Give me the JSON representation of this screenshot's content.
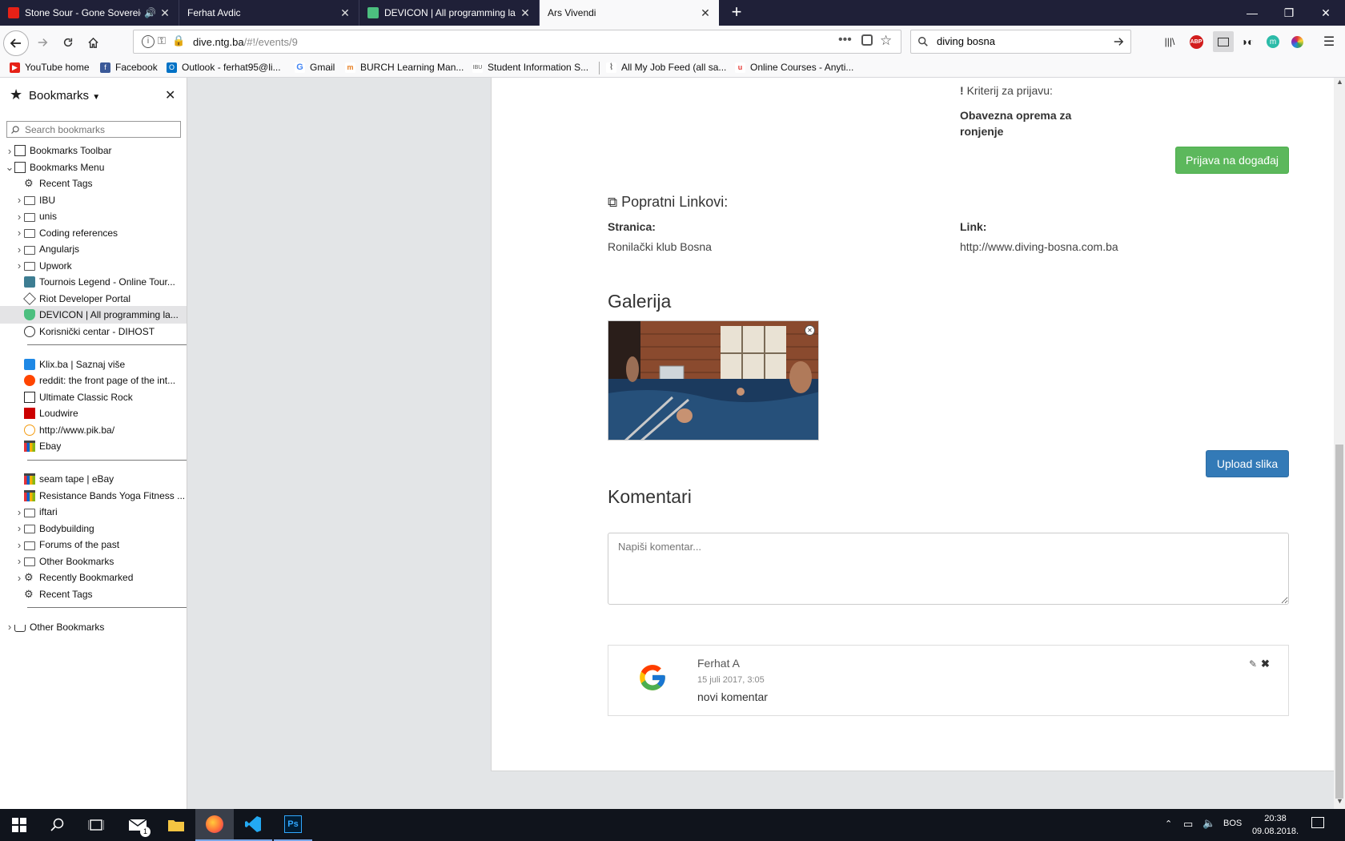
{
  "tabs": [
    {
      "title": "Stone Sour - Gone Sovereign",
      "favicon": "youtube-icon",
      "muted_icon": "speaker-icon"
    },
    {
      "title": "Ferhat Avdic",
      "favicon": "none"
    },
    {
      "title": "DEVICON | All programming la",
      "favicon": "shield-icon"
    },
    {
      "title": "Ars Vivendi",
      "favicon": "none",
      "active": true
    }
  ],
  "new_tab_label": "+",
  "nav": {
    "url_host": "dive.ntg.ba",
    "url_path": "/#!/events/9",
    "search_value": "diving bosna"
  },
  "bookmarks_toolbar": [
    "YouTube home",
    "Facebook",
    "Outlook - ferhat95@li...",
    "Gmail",
    "BURCH Learning Man...",
    "Student Information S...",
    "All My Job Feed (all sa...",
    "Online Courses - Anyti..."
  ],
  "sidebar": {
    "title": "Bookmarks",
    "search_placeholder": "Search bookmarks",
    "items": [
      {
        "label": "Bookmarks Toolbar",
        "level": 0,
        "twisty": "▶",
        "icon": "star-folder"
      },
      {
        "label": "Bookmarks Menu",
        "level": 0,
        "twisty": "▼",
        "icon": "menu-folder"
      },
      {
        "label": "Recent Tags",
        "level": 1,
        "twisty": "",
        "icon": "gear"
      },
      {
        "label": "IBU",
        "level": 1,
        "twisty": "▶",
        "icon": "folder"
      },
      {
        "label": "unis",
        "level": 1,
        "twisty": "▶",
        "icon": "folder"
      },
      {
        "label": "Coding references",
        "level": 1,
        "twisty": "▶",
        "icon": "folder"
      },
      {
        "label": "Angularjs",
        "level": 1,
        "twisty": "▶",
        "icon": "folder"
      },
      {
        "label": "Upwork",
        "level": 1,
        "twisty": "▶",
        "icon": "folder"
      },
      {
        "label": "Tournois Legend - Online Tour...",
        "level": 1,
        "twisty": "",
        "icon": "site-teal"
      },
      {
        "label": "Riot Developer Portal",
        "level": 1,
        "twisty": "",
        "icon": "site-riot"
      },
      {
        "label": "DEVICON | All programming la...",
        "level": 1,
        "twisty": "",
        "icon": "site-green",
        "selected": true
      },
      {
        "label": "Korisnički centar - DIHOST",
        "level": 1,
        "twisty": "",
        "icon": "site-dihost"
      },
      {
        "separator": true
      },
      {
        "label": "Klix.ba | Saznaj više",
        "level": 1,
        "twisty": "",
        "icon": "site-klix"
      },
      {
        "label": "reddit: the front page of the int...",
        "level": 1,
        "twisty": "",
        "icon": "site-reddit"
      },
      {
        "label": "Ultimate Classic Rock",
        "level": 1,
        "twisty": "",
        "icon": "site-ucr"
      },
      {
        "label": "Loudwire",
        "level": 1,
        "twisty": "",
        "icon": "site-loudwire"
      },
      {
        "label": "http://www.pik.ba/",
        "level": 1,
        "twisty": "",
        "icon": "site-pik"
      },
      {
        "label": "Ebay",
        "level": 1,
        "twisty": "",
        "icon": "site-ebay"
      },
      {
        "separator": true
      },
      {
        "label": "seam tape | eBay",
        "level": 1,
        "twisty": "",
        "icon": "site-ebay"
      },
      {
        "label": "Resistance Bands Yoga Fitness ...",
        "level": 1,
        "twisty": "",
        "icon": "site-ebay"
      },
      {
        "label": "iftari",
        "level": 1,
        "twisty": "▶",
        "icon": "folder"
      },
      {
        "label": "Bodybuilding",
        "level": 1,
        "twisty": "▶",
        "icon": "folder"
      },
      {
        "label": "Forums of the past",
        "level": 1,
        "twisty": "▶",
        "icon": "folder"
      },
      {
        "label": "Other Bookmarks",
        "level": 1,
        "twisty": "▶",
        "icon": "folder"
      },
      {
        "label": "Recently Bookmarked",
        "level": 1,
        "twisty": "▶",
        "icon": "gear"
      },
      {
        "label": "Recent Tags",
        "level": 1,
        "twisty": "",
        "icon": "gear"
      },
      {
        "separator": true
      },
      {
        "label": "Other Bookmarks",
        "level": 0,
        "twisty": "▶",
        "icon": "tray"
      }
    ]
  },
  "event": {
    "criteria_label": "Kriterij za prijavu:",
    "equipment_text": "Obavezna oprema za ronjenje",
    "register_button": "Prijava na događaj",
    "links_heading": "Popratni Linkovi:",
    "page_label": "Stranica:",
    "page_value": "Ronilački klub Bosna",
    "link_label": "Link:",
    "link_value": "http://www.diving-bosna.com.ba",
    "gallery_heading": "Galerija",
    "upload_button": "Upload slika",
    "comments_heading": "Komentari",
    "comment_placeholder": "Napiši komentar...",
    "comments": [
      {
        "author": "Ferhat A",
        "date": "15 juli 2017, 3:05",
        "text": "novi komentar",
        "avatar": "google-icon"
      }
    ]
  },
  "colors": {
    "success": "#5cb85c",
    "primary": "#337ab7",
    "tabbar": "#1f2038",
    "taskbar": "#10141c"
  },
  "taskbar": {
    "language": "BOS",
    "time": "20:38",
    "date": "09.08.2018.",
    "mail_badge": "1"
  }
}
